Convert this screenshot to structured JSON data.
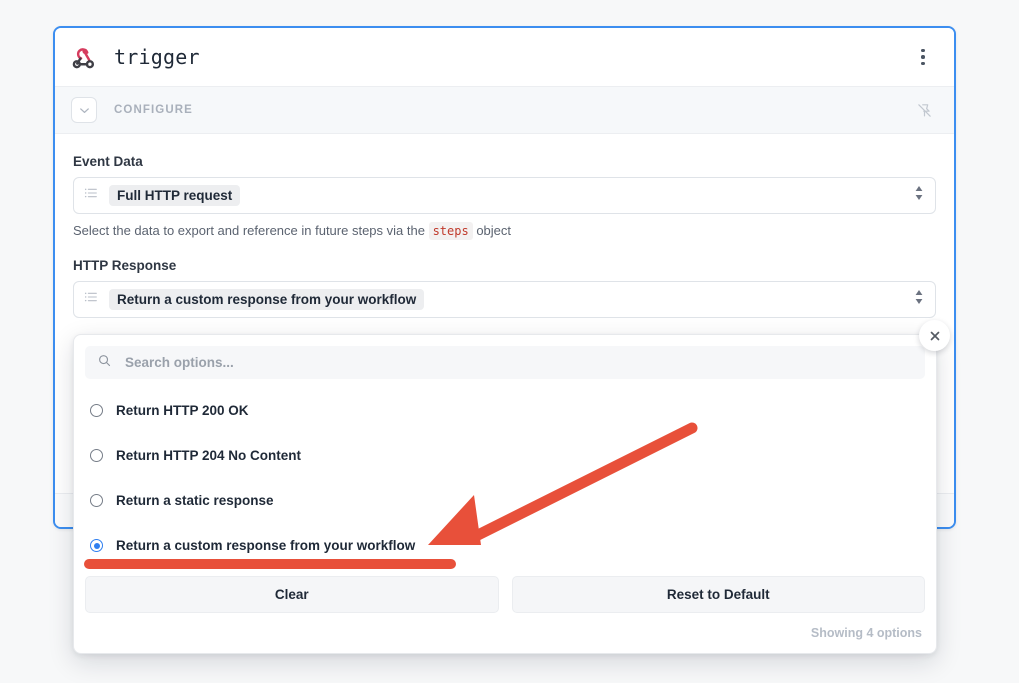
{
  "card": {
    "title": "trigger",
    "icon": "webhook-icon",
    "menu_icon": "kebab-menu-icon",
    "accent_color": "#3c8ef0"
  },
  "configure": {
    "label": "CONFIGURE",
    "collapse_icon": "chevron-down-icon",
    "pin_icon": "pin-off-icon"
  },
  "fields": {
    "event_data": {
      "label": "Event Data",
      "value": "Full HTTP request",
      "icon": "list-icon",
      "stepper_icon": "up-down-stepper-icon",
      "help_prefix": "Select the data to export and reference in future steps via the",
      "help_code": "steps",
      "help_suffix": "object"
    },
    "http_response": {
      "label": "HTTP Response",
      "value": "Return a custom response from your workflow",
      "icon": "list-icon",
      "stepper_icon": "up-down-stepper-icon"
    }
  },
  "dropdown": {
    "search": {
      "placeholder": "Search options...",
      "value": "",
      "icon": "search-icon"
    },
    "options": [
      {
        "label": "Return HTTP 200 OK",
        "selected": false
      },
      {
        "label": "Return HTTP 204 No Content",
        "selected": false
      },
      {
        "label": "Return a static response",
        "selected": false
      },
      {
        "label": "Return a custom response from your workflow",
        "selected": true
      }
    ],
    "clear_label": "Clear",
    "reset_label": "Reset to Default",
    "footer_text": "Showing 4 options"
  },
  "close_button": {
    "icon": "close-icon"
  },
  "annotations": {
    "arrow_color": "#e8503a",
    "underline_color": "#e8503a"
  }
}
